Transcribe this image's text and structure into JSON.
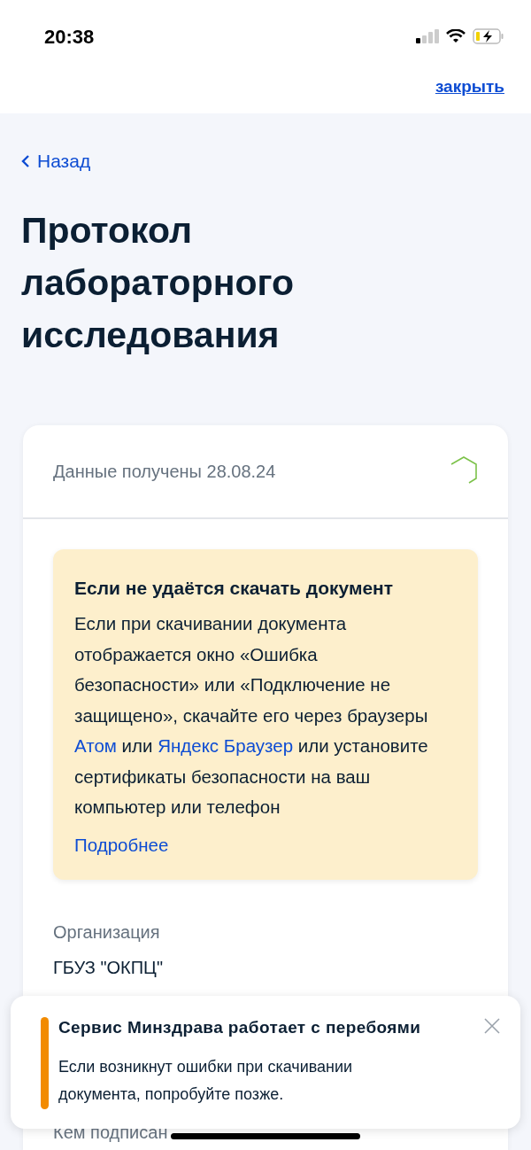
{
  "status_bar": {
    "time": "20:38"
  },
  "header": {
    "close_link": "закрыть"
  },
  "back_link": "Назад",
  "title": "Протокол лабораторного исследования",
  "card": {
    "received": "Данные получены 28.08.24",
    "warning": {
      "title": "Если не удаётся скачать документ",
      "body": [
        {
          "kind": "text",
          "text": "Если при скачивании документа отображается окно «Ошибка безопасности» или «Подключение не защищено», скачайте его через браузеры "
        },
        {
          "kind": "link",
          "text": "Атом"
        },
        {
          "kind": "text",
          "text": " или "
        },
        {
          "kind": "link",
          "text": "Яндекс Браузер"
        },
        {
          "kind": "text",
          "text": " или установите сертификаты безопасности на ваш компьютер или телефон"
        }
      ],
      "more_link": "Подробнее"
    },
    "fields": [
      {
        "label": "Организация",
        "value": "ГБУЗ \"ОКПЦ\""
      },
      {
        "label": "Кем подписан"
      }
    ]
  },
  "toast": {
    "title": "Сервис Минздрава работает с перебоями",
    "text": "Если возникнут ошибки при скачивании документа, попробуйте позже."
  }
}
